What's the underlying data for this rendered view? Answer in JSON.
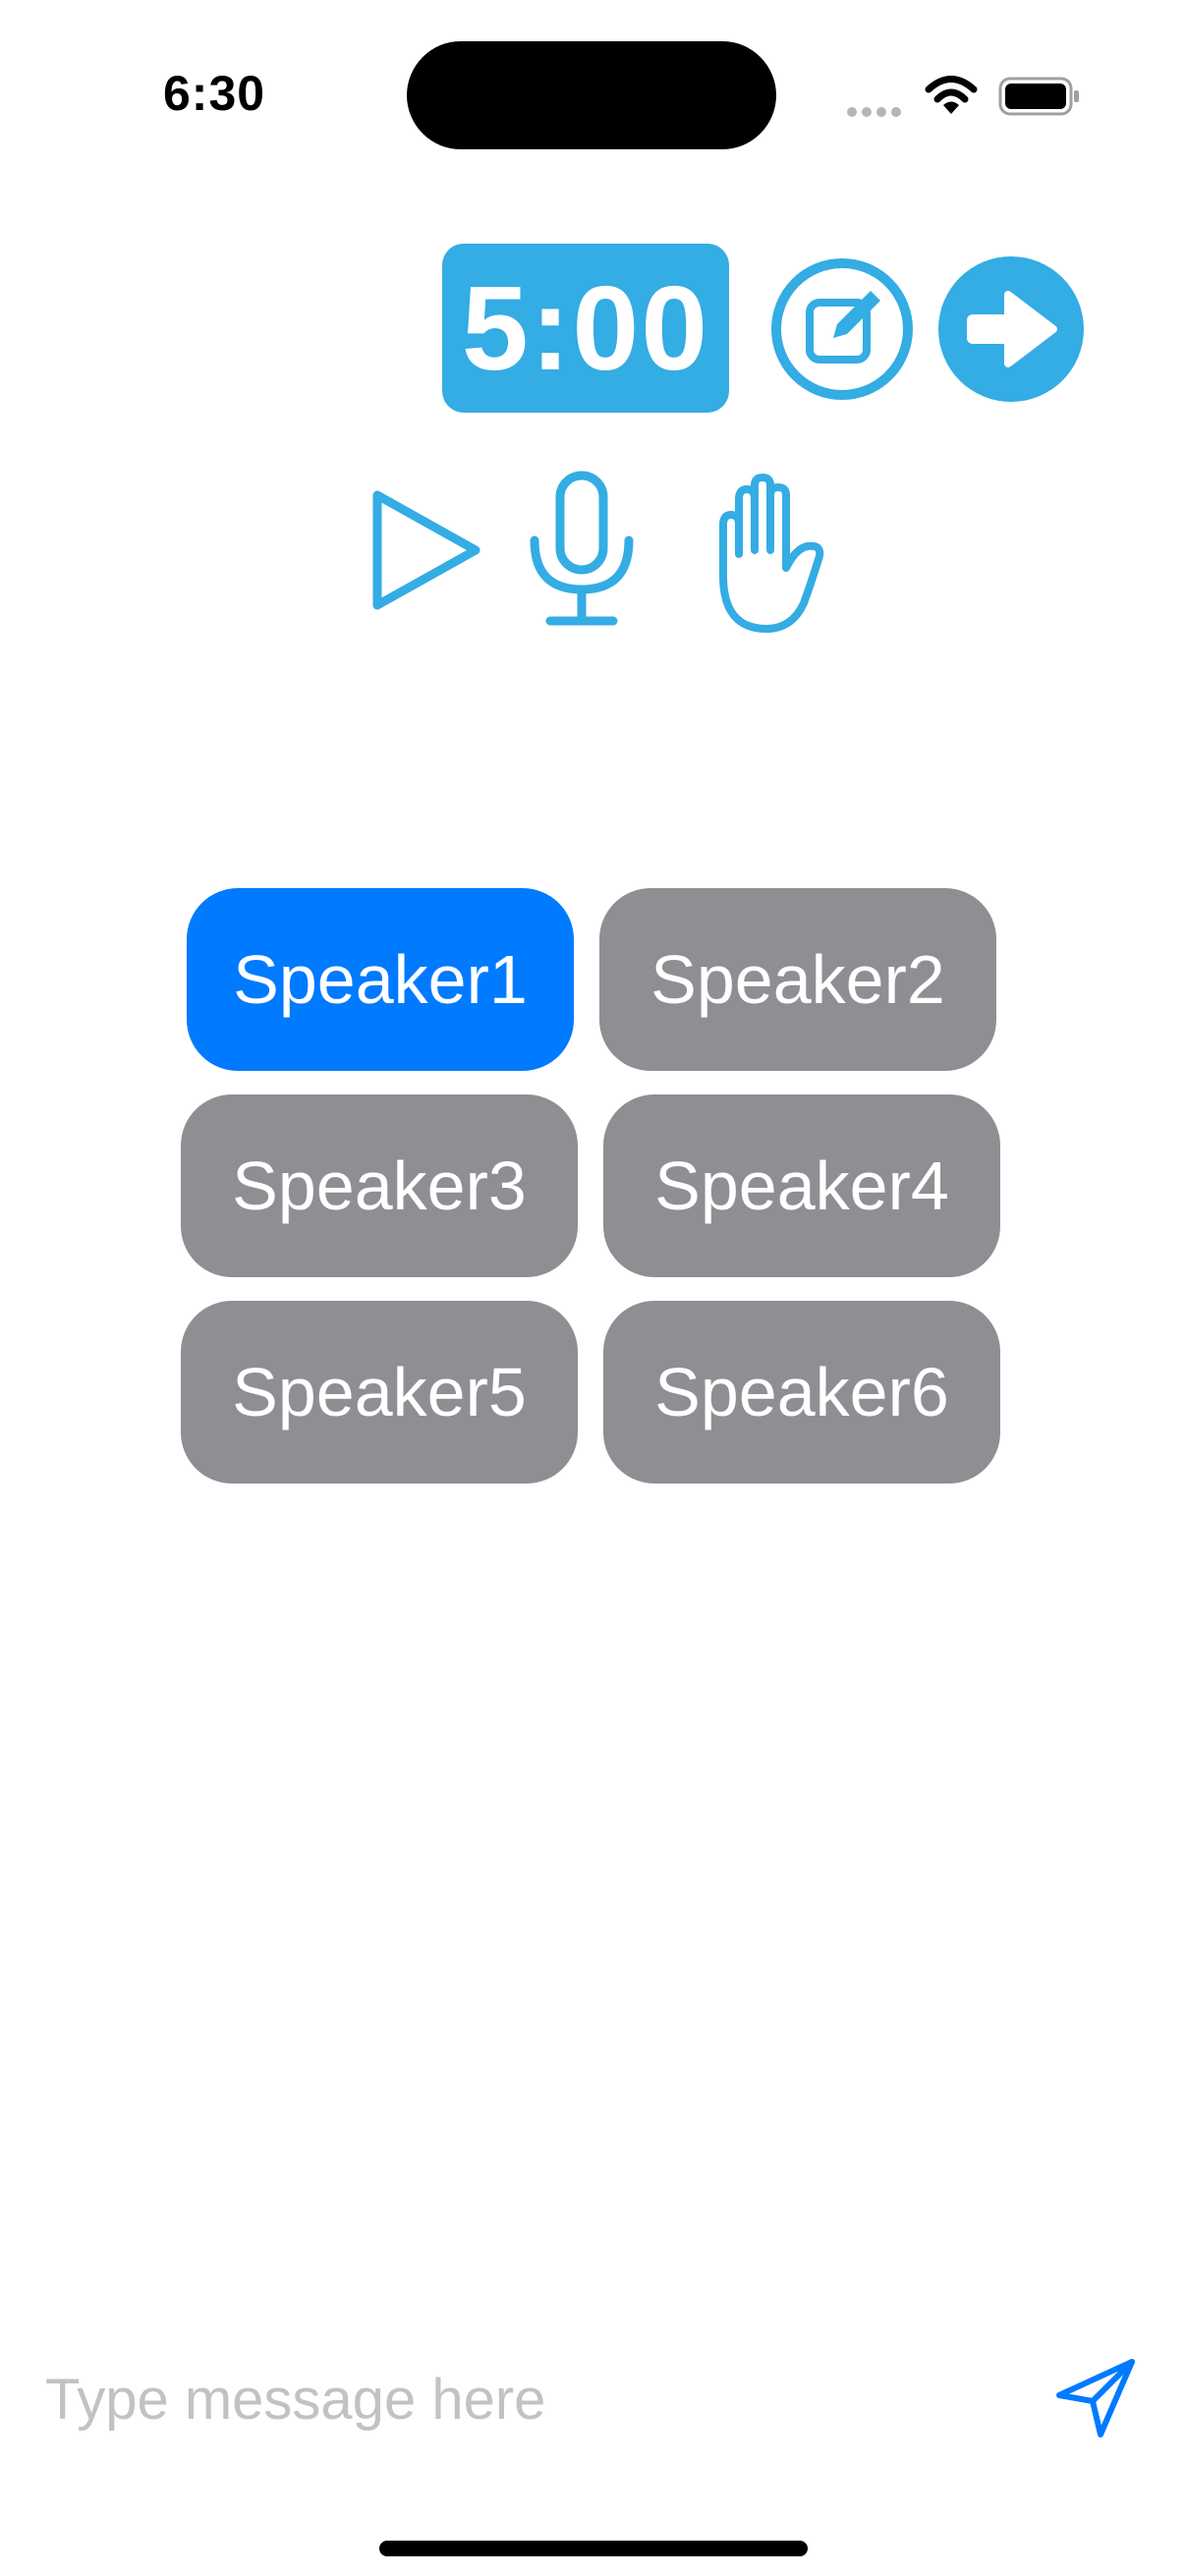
{
  "status_bar": {
    "time": "6:30"
  },
  "timer": {
    "display": "5:00"
  },
  "toolbar": {
    "icons": [
      "edit-icon",
      "arrow-right-icon",
      "play-icon",
      "microphone-icon",
      "raised-hand-icon"
    ]
  },
  "speakers": [
    {
      "label": "Speaker1",
      "active": true
    },
    {
      "label": "Speaker2",
      "active": false
    },
    {
      "label": "Speaker3",
      "active": false
    },
    {
      "label": "Speaker4",
      "active": false
    },
    {
      "label": "Speaker5",
      "active": false
    },
    {
      "label": "Speaker6",
      "active": false
    }
  ],
  "composer": {
    "placeholder": "Type message here",
    "value": ""
  },
  "colors": {
    "accent": "#34ace4",
    "active_speaker": "#007aff",
    "inactive_speaker": "#8e8e93",
    "send": "#007aff"
  }
}
